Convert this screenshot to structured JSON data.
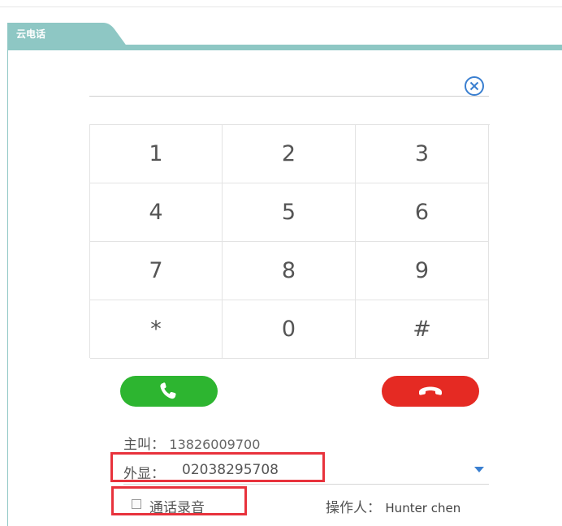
{
  "tab": {
    "label": "云电话"
  },
  "dialer": {
    "number_value": "",
    "number_placeholder": ""
  },
  "keypad": {
    "keys": [
      "1",
      "2",
      "3",
      "4",
      "5",
      "6",
      "7",
      "8",
      "9",
      "*",
      "0",
      "#"
    ]
  },
  "caller": {
    "label": "主叫：",
    "number": "13826009700"
  },
  "display": {
    "label": "外显：",
    "number": "02038295708"
  },
  "record": {
    "label": "通话录音",
    "checked": false
  },
  "operator": {
    "label": "操作人：",
    "name": "Hunter chen"
  },
  "colors": {
    "accent": "#8ec7c4",
    "call": "#2db530",
    "hangup": "#e52a23",
    "highlight": "#e8323c",
    "dropdown": "#3a7fd0"
  }
}
